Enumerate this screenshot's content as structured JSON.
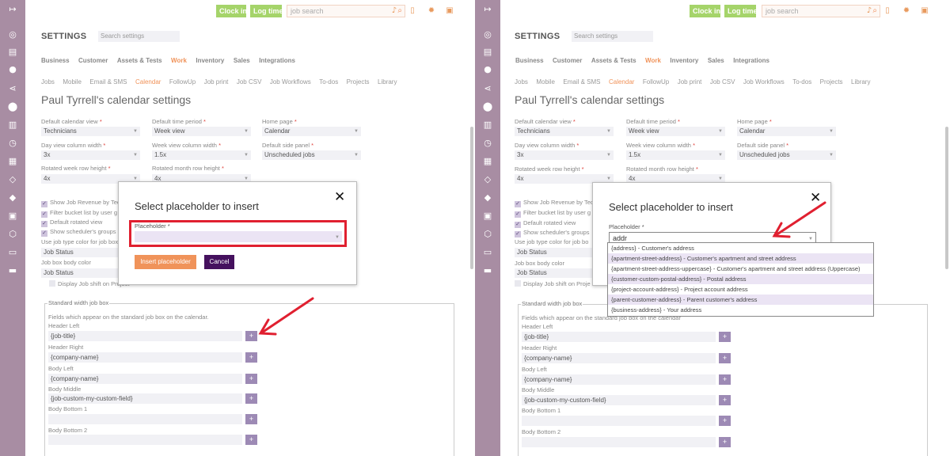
{
  "topbar": {
    "clock_in": "Clock in",
    "log_time": "Log time",
    "search_placeholder": "job search"
  },
  "settings": {
    "heading": "SETTINGS",
    "search_placeholder": "Search settings"
  },
  "tabs_main": [
    "Business",
    "Customer",
    "Assets & Tests",
    "Work",
    "Inventory",
    "Sales",
    "Integrations"
  ],
  "tabs_sub": [
    "Jobs",
    "Mobile",
    "Email & SMS",
    "Calendar",
    "FollowUp",
    "Job print",
    "Job CSV",
    "Job Workflows",
    "To-dos",
    "Projects",
    "Library"
  ],
  "title": "Paul Tyrrell's calendar settings",
  "fields": {
    "default_view_label": "Default calendar view",
    "default_view": "Technicians",
    "time_period_label": "Default time period",
    "time_period": "Week view",
    "home_page_label": "Home page",
    "home_page": "Calendar",
    "day_width_label": "Day view column width",
    "day_width": "3x",
    "week_width_label": "Week view column width",
    "week_width": "1.5x",
    "side_panel_label": "Default side panel",
    "side_panel": "Unscheduled jobs",
    "rot_week_label": "Rotated week row height",
    "rot_week": "4x",
    "rot_month_label": "Rotated month row height",
    "rot_month": "4x"
  },
  "checks": {
    "revenue": "Show Job Revenue by Tec",
    "revenue_right": "Show Job Revenue by Tec",
    "filter": "Filter bucket list by user g",
    "filter_right": "Filter bucket list by user g",
    "rotated": "Default rotated view",
    "scheduler_left": "Show scheduler's groups",
    "scheduler_right": "Show scheduler's groups",
    "jobtype_left": "Use job type color for job box",
    "jobtype_right": "Use job type color for job bo",
    "job_status": "Job Status",
    "body_color_left": "Job box body color",
    "body_color_right": "Job box body color",
    "body_status": "Job Status",
    "shift_left": "Display Job shift on Project",
    "shift_right": "Display Job shift on Proje"
  },
  "jobbox": {
    "legend": "Standard width job box",
    "desc_left": "Fields which appear on the standard job box on the calendar.",
    "desc_right": "Fields which appear on the standard job box on the calendar",
    "header_left_label": "Header Left",
    "header_left": "{job-title}",
    "header_right_label": "Header Right",
    "header_right": "{company-name}",
    "body_left_label": "Body Left",
    "body_left": "{company-name}",
    "body_middle_label": "Body Middle",
    "body_middle": "{job-custom-my-custom-field}",
    "body_bottom1_label": "Body Bottom 1",
    "body_bottom2_label": "Body Bottom 2",
    "plus": "+"
  },
  "modal": {
    "title": "Select placeholder to insert",
    "close": "✕",
    "label": "Placeholder",
    "required": "*",
    "typed_value": "addr",
    "insert_btn": "Insert placeholder",
    "cancel_btn": "Cancel"
  },
  "dropdown_options": [
    "{address} - Customer's address",
    "{apartment-street-address} - Customer's apartment and street address",
    "{apartment-street-address-uppercase} - Customer's apartment and street address (Uppercase)",
    "{customer-custom-postal-address} - Postal address",
    "{project-account-address} - Project account address",
    "{parent-customer-address} - Parent customer's address",
    "{business-address} - Your address"
  ],
  "colors": {
    "sidebar": "#a88da3",
    "accent_orange": "#f0935a",
    "clock_green": "#a5d46a",
    "cancel_purple": "#45115e",
    "annotation_red": "#e02030"
  },
  "icons": {
    "sidebar": [
      "collapse-icon",
      "briefcase-icon",
      "document-icon",
      "person-icon",
      "share-icon",
      "map-pin-icon",
      "chart-icon",
      "clock-icon",
      "calculator-icon",
      "box-icon",
      "tag-icon",
      "scan-icon",
      "shield-icon",
      "book-icon",
      "reader-icon"
    ],
    "top": [
      "bell-icon",
      "phone-icon",
      "gear-icon",
      "inbox-icon"
    ]
  }
}
